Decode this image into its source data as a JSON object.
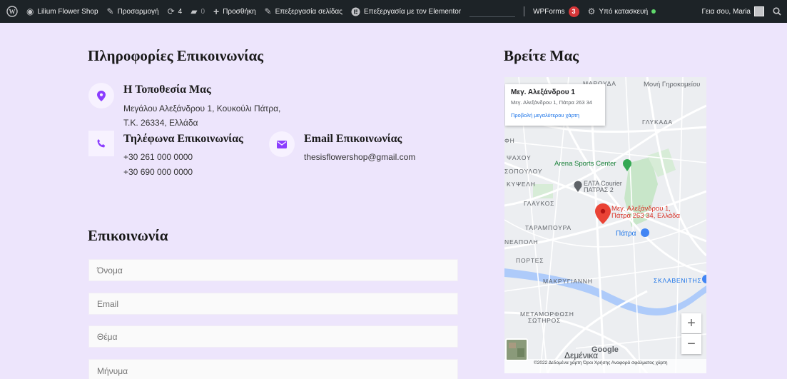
{
  "admin_bar": {
    "site_name": "Lilium Flower Shop",
    "customize": "Προσαρμογή",
    "updates_count": "4",
    "comments_count": "0",
    "new_label": "Προσθήκη",
    "edit_page": "Επεξεργασία σελίδας",
    "edit_elementor": "Επεξεργασία με τον Elementor",
    "wpforms": "WPForms",
    "wpforms_badge": "3",
    "maintenance": "Υπό κατασκευή",
    "greeting": "Γεια σου, Maria"
  },
  "contact_info": {
    "heading": "Πληροφορίες Επικοινωνίας",
    "location": {
      "title": "Η Τοποθεσία Μας",
      "line1": "Μεγάλου Αλεξάνδρου 1, Κουκούλι Πάτρα,",
      "line2": "Τ.Κ. 26334, Ελλάδα"
    },
    "phones": {
      "title": "Τηλέφωνα Επικοινωνίας",
      "phone1": "+30 261 000 0000",
      "phone2": "+30 690 000 0000"
    },
    "email": {
      "title": "Email Επικοινωνίας",
      "address": "thesisflowershop@gmail.com"
    }
  },
  "form": {
    "heading": "Επικοινωνία",
    "name_placeholder": "Όνομα",
    "email_placeholder": "Email",
    "subject_placeholder": "Θέμα",
    "message_placeholder": "Μήνυμα"
  },
  "map": {
    "heading": "Βρείτε Μας",
    "card_title": "Μεγ. Αλεξάνδρου 1",
    "card_address": "Μεγ. Αλεξάνδρου 1, Πάτρα 263 34",
    "card_link": "Προβολή μεγαλύτερου χάρτη",
    "labels": {
      "marouda": "ΜΑΡΟΥΔΑ",
      "moni": "Μονή Γηροκομείου",
      "glykada": "ΓΛΥΚΑΔΑ",
      "fi": "ΦΗ",
      "psaxou": "ΨΑΧΟΥ",
      "arena": "Arena Sports Center",
      "sopoulou": "ΣΟΠΟΥΛΟΥ",
      "kyfelh": "ΚΥΨΕΛΗ",
      "elta": "ΕΛΤΑ Courier",
      "elta2": "ΠΑΤΡΑΣ 2",
      "glaukos": "ΓΛΑΥΚΟΣ",
      "marker_line1": "Μεγ. Αλεξάνδρου 1,",
      "marker_line2": "Πάτρα 263 34, Ελλάδα",
      "tarampoura": "ΤΑΡΑΜΠΟΥΡΑ",
      "patra": "Πάτρα",
      "neapolh": "ΝΕΑΠΟΛΗ",
      "portes": "ΠΟΡΤΕΣ",
      "makrygianni": "ΜΑΚΡΥΓΙΑΝΝΗ",
      "sklavenitis": "ΣΚΛΑΒΕΝΙΤΗΣ",
      "metamorfosi1": "ΜΕΤΑΜΟΡΦΩΣΗ",
      "metamorfosi2": "ΣΩΤΗΡΟΣ",
      "demenika": "Δεμένικα",
      "google": "Google"
    },
    "zoom_in": "+",
    "zoom_out": "−",
    "footer": "©2022 Δεδομένα χάρτη   Όροι Χρήσης   Αναφορά σφάλματος χάρτη",
    "colors": {
      "marker": "#ea4335",
      "river": "#aecbfa",
      "park": "#c5e8c5",
      "poi_blue": "#4285f4",
      "poi_green": "#34a853"
    }
  },
  "theme": {
    "background": "#ede5fc",
    "accent": "#8b3dff",
    "admin_bar": "#1d2327"
  }
}
